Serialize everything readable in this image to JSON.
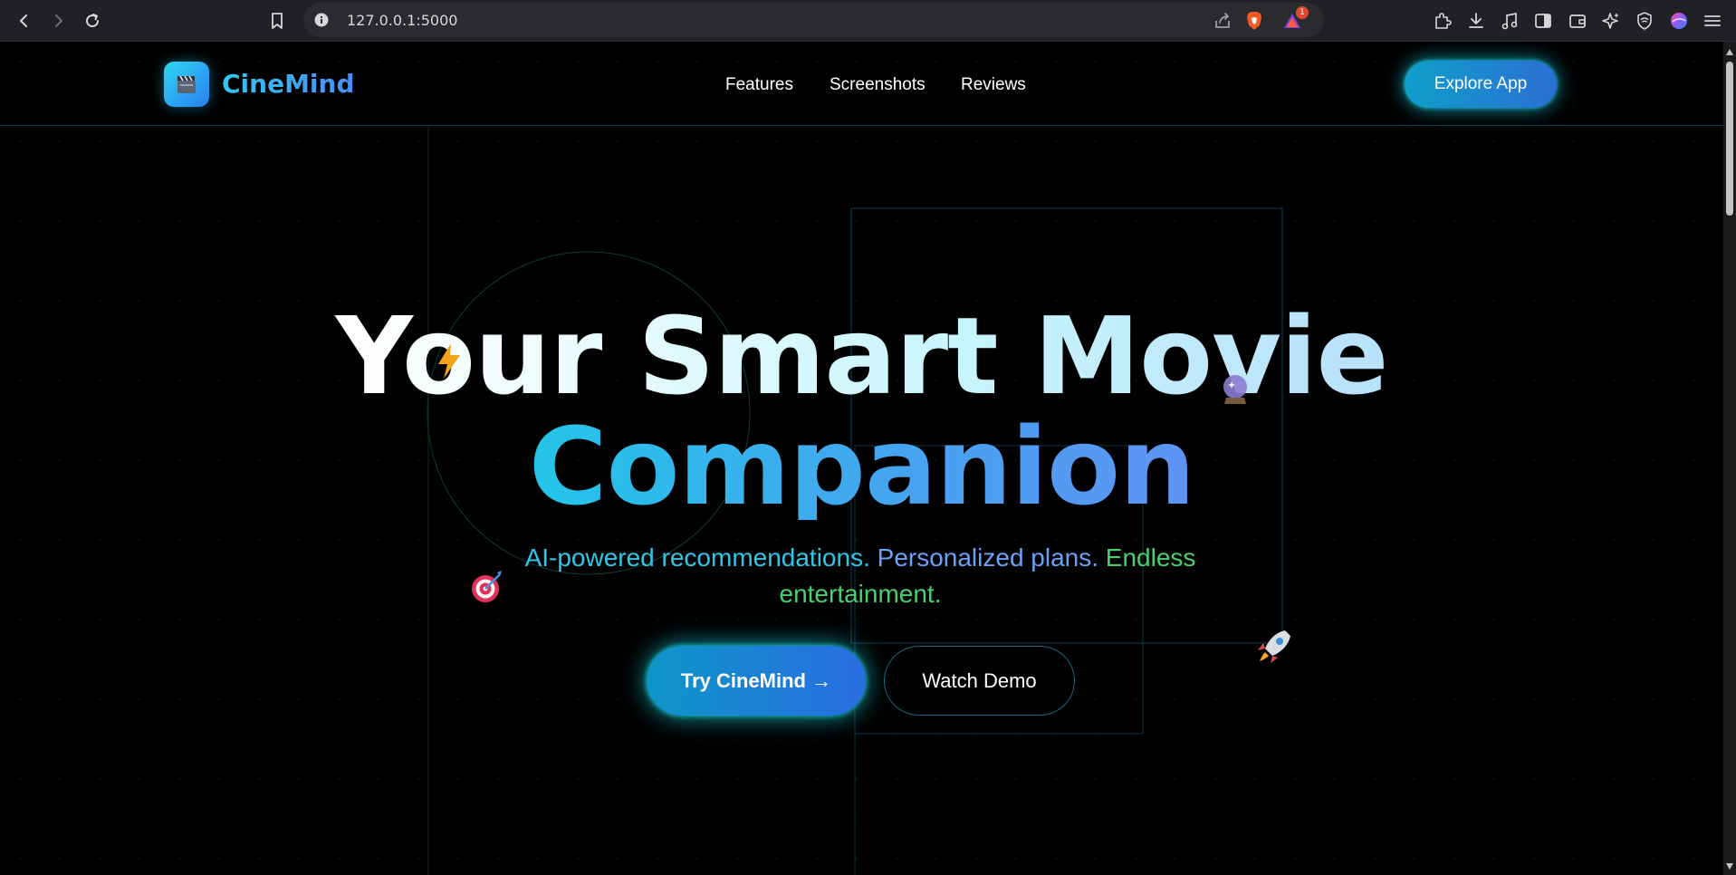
{
  "browser": {
    "url": "127.0.0.1:5000",
    "notification_count": "1"
  },
  "header": {
    "brand": "CineMind",
    "nav": [
      "Features",
      "Screenshots",
      "Reviews"
    ],
    "cta": "Explore App"
  },
  "hero": {
    "title_line1": "Your Smart Movie",
    "title_line2": "Companion",
    "subtitle_part1": "AI-powered recommendations.",
    "subtitle_part2": "Personalized plans.",
    "subtitle_part3": "Endless entertainment.",
    "primary_button": "Try CineMind →",
    "secondary_button": "Watch Demo"
  },
  "colors": {
    "accent_cyan": "#22c6e8",
    "accent_blue": "#2b6fd4",
    "accent_green": "#48d06f",
    "background": "#000000"
  },
  "icons": [
    "back-icon",
    "forward-icon",
    "reload-icon",
    "bookmark-icon",
    "info-icon",
    "share-icon",
    "brave-shield-icon",
    "rewards-icon",
    "extensions-icon",
    "download-icon",
    "music-icon",
    "sidebar-icon",
    "wallet-icon",
    "leo-icon",
    "vpn-icon",
    "profile-icon",
    "menu-icon",
    "clapper-icon",
    "lightning-icon",
    "crystal-ball-icon",
    "target-icon",
    "rocket-icon"
  ]
}
